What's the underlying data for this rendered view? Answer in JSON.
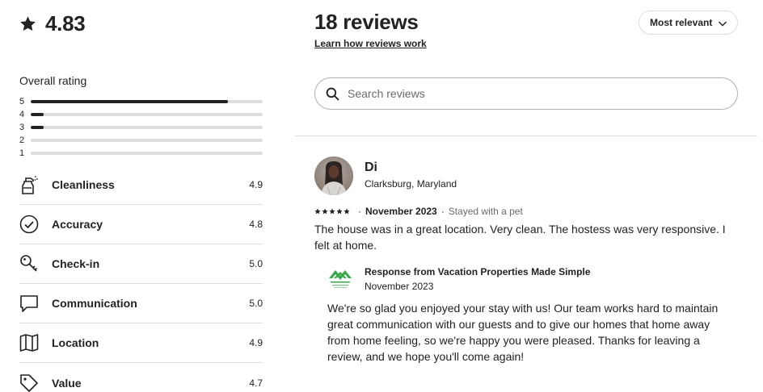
{
  "summary": {
    "score": "4.83",
    "star_icon": "star-icon"
  },
  "overall": {
    "title": "Overall rating",
    "rows": [
      {
        "label": "5",
        "fraction": 0.85
      },
      {
        "label": "4",
        "fraction": 0.055
      },
      {
        "label": "3",
        "fraction": 0.055
      },
      {
        "label": "2",
        "fraction": 0.0
      },
      {
        "label": "1",
        "fraction": 0.0
      }
    ]
  },
  "categories": [
    {
      "label": "Cleanliness",
      "value": "4.9",
      "icon": "spray-bottle-icon"
    },
    {
      "label": "Accuracy",
      "value": "4.8",
      "icon": "check-circle-icon"
    },
    {
      "label": "Check-in",
      "value": "5.0",
      "icon": "key-icon"
    },
    {
      "label": "Communication",
      "value": "5.0",
      "icon": "chat-bubble-icon"
    },
    {
      "label": "Location",
      "value": "4.9",
      "icon": "map-icon"
    },
    {
      "label": "Value",
      "value": "4.7",
      "icon": "tag-icon"
    }
  ],
  "reviews_header": {
    "title": "18 reviews",
    "learn_link": "Learn how reviews work",
    "sort_label": "Most relevant"
  },
  "search": {
    "placeholder": "Search reviews"
  },
  "review": {
    "name": "Di",
    "location": "Clarksburg, Maryland",
    "rating": 5,
    "date": "November 2023",
    "stay_info": "Stayed with a pet",
    "text": "The house was in a great location. Very clean. The hostess was very responsive. I felt at home.",
    "response": {
      "title": "Response from Vacation Properties Made Simple",
      "date": "November 2023",
      "text": "We're so glad you enjoyed your stay with us! Our team works hard to maintain great communication with our guests and to give our homes that home away from home feeling, so we're happy you were pleased. Thanks for leaving a review, and we hope you'll come again!"
    }
  },
  "colors": {
    "text": "#222222",
    "muted": "#6a6a6a",
    "border": "#dddddd",
    "logo_green": "#3aa84a"
  }
}
